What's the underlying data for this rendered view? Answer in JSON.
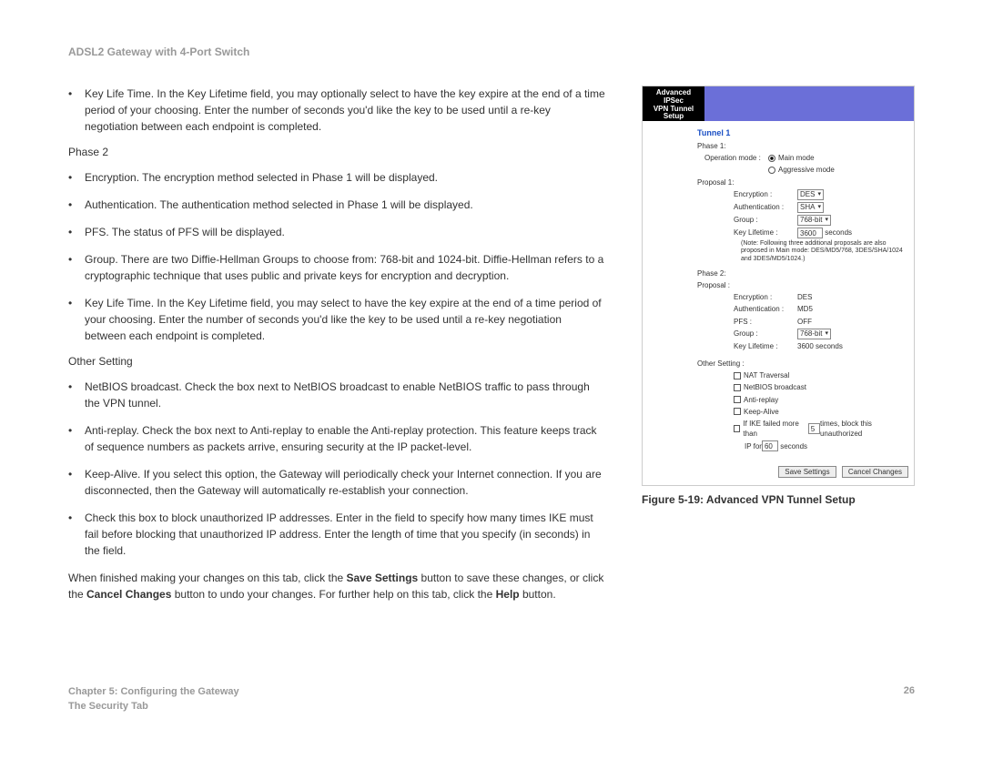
{
  "header": {
    "title": "ADSL2 Gateway with 4-Port Switch"
  },
  "content": {
    "intro_bullet": "Key Life Time. In the Key Lifetime field, you may optionally select to have the key expire at the end of a time period of your choosing.  Enter the number of seconds you'd like the key to be used until a re-key negotiation between each endpoint is completed.",
    "phase2_label": "Phase 2",
    "phase2_bullets": [
      "Encryption. The encryption method selected in Phase 1 will be displayed.",
      "Authentication. The authentication method selected in Phase 1 will be displayed.",
      "PFS. The status of PFS will be displayed.",
      "Group. There are two Diffie-Hellman Groups to choose from: 768-bit and 1024-bit. Diffie-Hellman refers to a cryptographic technique that uses public and private keys for encryption and decryption.",
      "Key Life Time. In the Key Lifetime field, you may select to have the key expire at the end of a time period of your choosing.  Enter the number of seconds you'd like the key to be used until a re-key negotiation between each endpoint is completed."
    ],
    "other_label": "Other Setting",
    "other_bullets": [
      "NetBIOS broadcast. Check the box next to NetBIOS broadcast to enable NetBIOS traffic to pass through the VPN tunnel.",
      "Anti-replay. Check the box next to Anti-replay to enable the Anti-replay protection. This feature keeps track of sequence numbers as packets arrive, ensuring security at the IP packet-level.",
      "Keep-Alive. If you select this option, the Gateway will periodically check your Internet connection. If you are disconnected, then the Gateway will automatically re-establish your connection.",
      "Check this box to block unauthorized IP addresses. Enter in the field to specify how many times IKE must fail before blocking that unauthorized IP address. Enter the length of time that you specify (in seconds) in the field."
    ],
    "closing_pre": "When finished making your changes on this tab, click the ",
    "save_btn": "Save Settings",
    "closing_mid": " button to save these changes, or click the ",
    "cancel_btn": "Cancel Changes",
    "closing_post1": " button to undo your changes. For further help on this tab, click the ",
    "help_btn": "Help",
    "closing_post2": " button."
  },
  "figure": {
    "caption": "Figure 5-19: Advanced VPN Tunnel Setup",
    "header_l1": "Advanced IPSec",
    "header_l2": "VPN Tunnel",
    "header_l3": "Setup",
    "tunnel_label": "Tunnel 1",
    "phase1_label": "Phase 1:",
    "op_mode_label": "Operation mode :",
    "op_main": "Main mode",
    "op_aggr": "Aggressive mode",
    "proposal1_label": "Proposal 1:",
    "enc_label": "Encryption :",
    "enc_val": "DES",
    "auth_label": "Authentication :",
    "auth_val": "SHA",
    "group_label": "Group :",
    "group_val": "768-bit",
    "keylife_label": "Key Lifetime :",
    "keylife_val": "3600",
    "seconds": "seconds",
    "note": "(Note: Following three additional proposals are also proposed in Main mode: DES/MD5/768, 3DES/SHA/1024 and 3DES/MD5/1024.)",
    "phase2_label": "Phase 2:",
    "proposal_label": "Proposal :",
    "p2_enc_label": "Encryption :",
    "p2_enc_val": "DES",
    "p2_auth_label": "Authentication :",
    "p2_auth_val": "MD5",
    "p2_pfs_label": "PFS :",
    "p2_pfs_val": "OFF",
    "p2_group_label": "Group :",
    "p2_group_val": "768-bit",
    "p2_keylife_label": "Key Lifetime :",
    "p2_keylife_val": "3600 seconds",
    "other_label": "Other Setting :",
    "nat": "NAT Traversal",
    "netbios": "NetBIOS broadcast",
    "anti": "Anti-replay",
    "keep": "Keep-Alive",
    "ike_pre": "If IKE failed more than ",
    "ike_val": "5",
    "ike_post": " times, block this unauthorized",
    "ip_pre": "IP for ",
    "ip_val": "60",
    "ip_post": " seconds",
    "save": "Save Settings",
    "cancel": "Cancel Changes"
  },
  "footer": {
    "chapter": "Chapter 5: Configuring the Gateway",
    "section": "The Security Tab",
    "page": "26"
  }
}
